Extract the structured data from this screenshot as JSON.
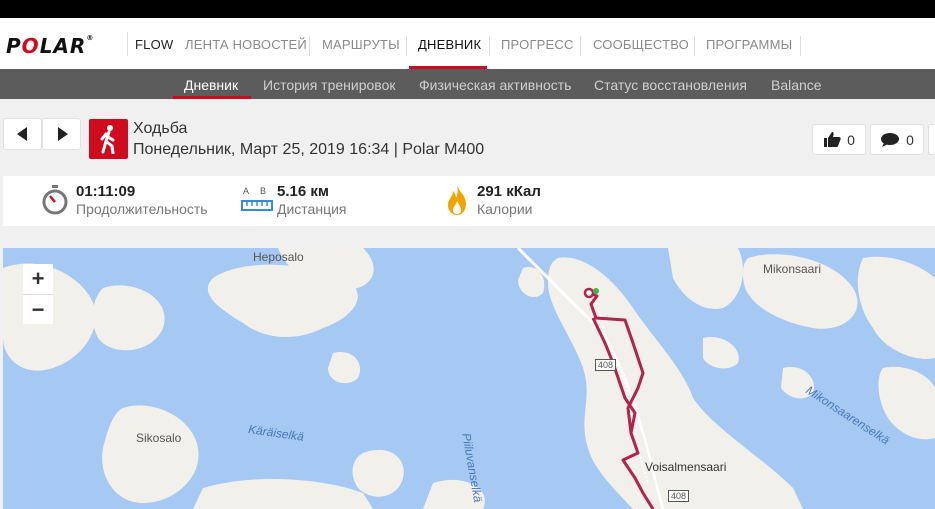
{
  "brand": {
    "logo": "POLAR",
    "product": "FLOW"
  },
  "nav": {
    "items": [
      "ЛЕНТА НОВОСТЕЙ",
      "МАРШРУТЫ",
      "ДНЕВНИК",
      "ПРОГРЕСС",
      "СООБЩЕСТВО",
      "ПРОГРАММЫ"
    ],
    "active": "ДНЕВНИК"
  },
  "subnav": {
    "items": [
      "Дневник",
      "История тренировок",
      "Физическая активность",
      "Статус восстановления",
      "Balance"
    ],
    "active": "Дневник"
  },
  "activity": {
    "title": "Ходьба",
    "subtitle": "Понедельник, Март 25, 2019 16:34 | Polar M400",
    "likes": "0",
    "comments": "0"
  },
  "stats": {
    "duration": {
      "value": "01:11:09",
      "label": "Продолжительность"
    },
    "distance": {
      "value": "5.16 км",
      "label": "Дистанция",
      "ab": "A B"
    },
    "calories": {
      "value": "291 кКал",
      "label": "Калории"
    }
  },
  "map": {
    "labels": {
      "heposalo": "Heposalo",
      "mikonsaari": "Mikonsaari",
      "sikosalo": "Sikosalo",
      "karaiselka": "Käräiselkä",
      "piiluvanselka": "Piiluvanselkä",
      "mikonsaarenselka": "Mikonsaarenselkä",
      "voisalmensaari": "Voisalmensaari",
      "road1": "408",
      "road2": "408"
    },
    "zoom_in": "+",
    "zoom_out": "−"
  },
  "colors": {
    "accent": "#d10b1e",
    "route": "#b3234a"
  },
  "icons": {
    "prev": "prev-arrow-icon",
    "next": "next-arrow-icon",
    "activity": "walking-icon",
    "like": "thumbs-up-icon",
    "comment": "comment-icon",
    "duration": "stopwatch-icon",
    "distance": "ruler-icon",
    "calories": "flame-icon"
  }
}
